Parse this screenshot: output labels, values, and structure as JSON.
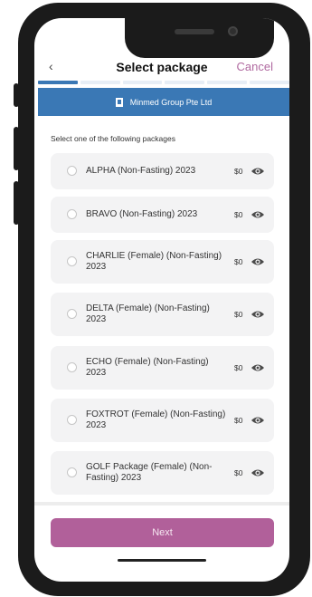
{
  "header": {
    "back_icon": "‹",
    "title": "Select package",
    "cancel_label": "Cancel"
  },
  "progress": {
    "total_steps": 6,
    "current_step": 1
  },
  "company": {
    "icon": "building-icon",
    "name": "Minmed Group Pte Ltd"
  },
  "instruction": "Select one of the following packages",
  "packages": [
    {
      "name": "ALPHA (Non-Fasting) 2023",
      "price": "$0"
    },
    {
      "name": "BRAVO (Non-Fasting) 2023",
      "price": "$0"
    },
    {
      "name": "CHARLIE (Female) (Non-Fasting) 2023",
      "price": "$0"
    },
    {
      "name": "DELTA (Female) (Non-Fasting) 2023",
      "price": "$0"
    },
    {
      "name": "ECHO (Female) (Non-Fasting) 2023",
      "price": "$0"
    },
    {
      "name": "FOXTROT (Female) (Non-Fasting) 2023",
      "price": "$0"
    },
    {
      "name": "GOLF Package (Female) (Non-Fasting) 2023",
      "price": "$0"
    }
  ],
  "next_label": "Next",
  "colors": {
    "primary_blue": "#3a78b5",
    "accent_purple": "#b1609a",
    "cancel": "#b06aa0"
  }
}
